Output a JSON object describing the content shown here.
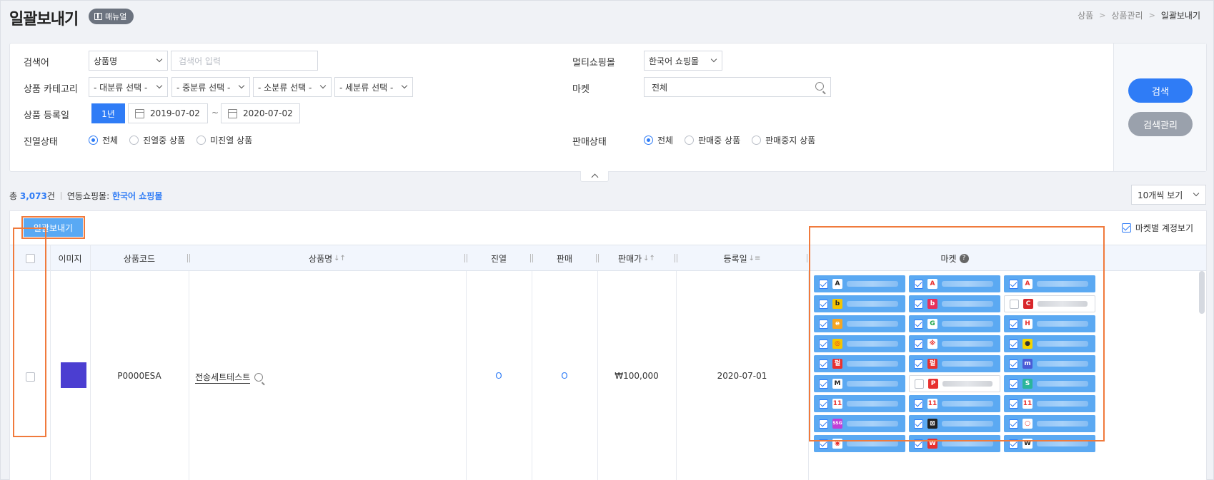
{
  "header": {
    "title": "일괄보내기",
    "manual_label": "매뉴얼",
    "breadcrumb": [
      "상품",
      "상품관리",
      "일괄보내기"
    ]
  },
  "search": {
    "keyword_label": "검색어",
    "keyword_type": "상품명",
    "keyword_placeholder": "검색어 입력",
    "category_label": "상품 카테고리",
    "categories": [
      "- 대분류 선택 -",
      "- 중분류 선택 -",
      "- 소분류 선택 -",
      "- 세분류 선택 -"
    ],
    "date_label": "상품 등록일",
    "period_btn": "1년",
    "date_from": "2019-07-02",
    "date_sep": "~",
    "date_to": "2020-07-02",
    "display_label": "진열상태",
    "display_options": [
      "전체",
      "진열중 상품",
      "미진열 상품"
    ],
    "multi_mall_label": "멀티쇼핑몰",
    "multi_mall_value": "한국어 쇼핑몰",
    "market_label": "마켓",
    "market_value": "전체",
    "sale_label": "판매상태",
    "sale_options": [
      "전체",
      "판매중 상품",
      "판매중지 상품"
    ],
    "search_btn": "검색",
    "manage_btn": "검색관리"
  },
  "summary": {
    "total_prefix": "총",
    "total_count": "3,073",
    "total_suffix": "건",
    "linked_label": "연동쇼핑몰:",
    "linked_mall": "한국어 쇼핑몰",
    "per_page": "10개씩 보기"
  },
  "list": {
    "bulk_btn": "일괄보내기",
    "account_toggle": "마켓별 계정보기",
    "columns": [
      "이미지",
      "상품코드",
      "상품명",
      "진열",
      "판매",
      "판매가",
      "등록일",
      "마켓"
    ],
    "row": {
      "code": "P0000ESA",
      "name": "전송세트테스트",
      "display": "O",
      "sale": "O",
      "price": "₩100,000",
      "date": "2020-07-01"
    }
  },
  "markets": [
    {
      "logo": "A",
      "fg": "#222",
      "bg": "#fff",
      "on": true
    },
    {
      "logo": "A",
      "fg": "#e8312f",
      "bg": "#fff",
      "on": true
    },
    {
      "logo": "A",
      "fg": "#e8312f",
      "bg": "#fff",
      "on": true
    },
    {
      "logo": "b",
      "fg": "#222",
      "bg": "#f5c400",
      "on": true
    },
    {
      "logo": "b",
      "fg": "#fff",
      "bg": "#e8315a",
      "on": true
    },
    {
      "logo": "C",
      "fg": "#fff",
      "bg": "#d8262b",
      "on": false
    },
    {
      "logo": "e",
      "fg": "#fff",
      "bg": "#f5a623",
      "on": true
    },
    {
      "logo": "G",
      "fg": "#1aa34a",
      "bg": "#fff",
      "on": true
    },
    {
      "logo": "H",
      "fg": "#e8312f",
      "bg": "#fff",
      "on": true
    },
    {
      "logo": "◎",
      "fg": "#e8312f",
      "bg": "#f5c400",
      "on": true
    },
    {
      "logo": "※",
      "fg": "#e8312f",
      "bg": "#fff",
      "on": true
    },
    {
      "logo": "●",
      "fg": "#333",
      "bg": "#f5d400",
      "on": true
    },
    {
      "logo": "펄",
      "fg": "#fff",
      "bg": "#e8312f",
      "on": true
    },
    {
      "logo": "펄",
      "fg": "#fff",
      "bg": "#e8312f",
      "on": true
    },
    {
      "logo": "m",
      "fg": "#fff",
      "bg": "#4a5bd6",
      "on": true
    },
    {
      "logo": "M",
      "fg": "#222",
      "bg": "#fff",
      "on": true
    },
    {
      "logo": "P",
      "fg": "#fff",
      "bg": "#e8312f",
      "on": false
    },
    {
      "logo": "S",
      "fg": "#fff",
      "bg": "#2bb59a",
      "on": true
    },
    {
      "logo": "11",
      "fg": "#e8312f",
      "bg": "#fff",
      "on": true
    },
    {
      "logo": "11",
      "fg": "#e8312f",
      "bg": "#fff",
      "on": true
    },
    {
      "logo": "11",
      "fg": "#e8312f",
      "bg": "#fff",
      "on": true
    },
    {
      "logo": "SSG",
      "fg": "#fff",
      "bg": "#c23ed6",
      "on": true
    },
    {
      "logo": "⊠",
      "fg": "#fff",
      "bg": "#222",
      "on": true
    },
    {
      "logo": "○",
      "fg": "#e8312f",
      "bg": "#fff",
      "on": true
    },
    {
      "logo": "◉",
      "fg": "#e8312f",
      "bg": "#fff",
      "on": true
    },
    {
      "logo": "W",
      "fg": "#fff",
      "bg": "#e8312f",
      "on": true
    },
    {
      "logo": "W",
      "fg": "#222",
      "bg": "#fff",
      "on": true
    }
  ]
}
